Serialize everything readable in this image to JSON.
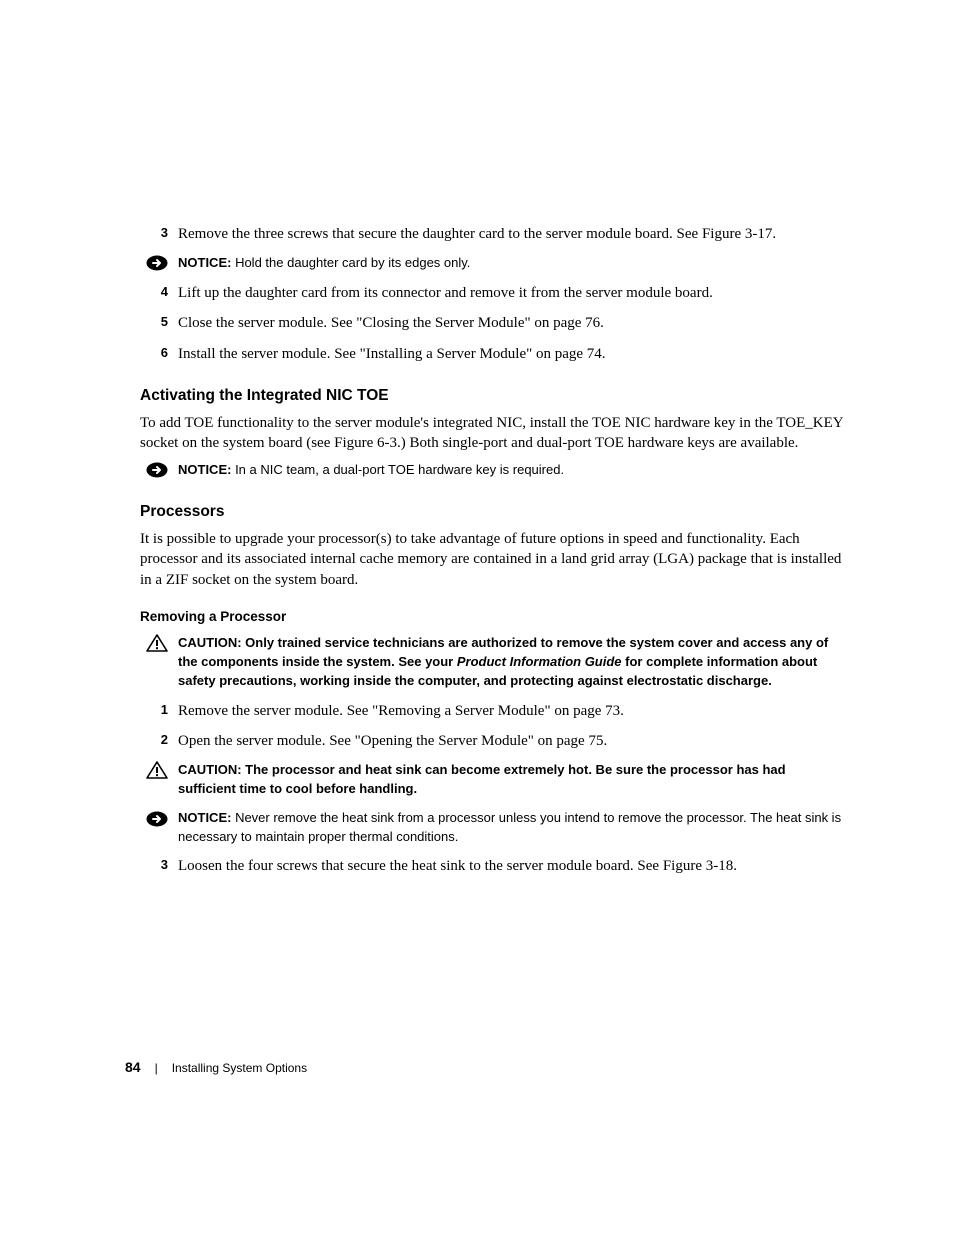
{
  "step3": {
    "num": "3",
    "text": "Remove the three screws that secure the daughter card to the server module board. See Figure 3-17."
  },
  "notice1": {
    "label": "NOTICE:",
    "text": " Hold the daughter card by its edges only."
  },
  "step4": {
    "num": "4",
    "text": "Lift up the daughter card from its connector and remove it from the server module board."
  },
  "step5": {
    "num": "5",
    "text": "Close the server module. See \"Closing the Server Module\" on page 76."
  },
  "step6": {
    "num": "6",
    "text": "Install the server module. See \"Installing a Server Module\" on page 74."
  },
  "sec1": {
    "title": "Activating the Integrated NIC TOE",
    "para": "To add TOE functionality to the server module's integrated NIC, install the TOE NIC hardware key in the TOE_KEY socket on the system board (see Figure 6-3.) Both single-port and dual-port TOE hardware keys are available."
  },
  "notice2": {
    "label": "NOTICE:",
    "text": " In a NIC team, a dual-port TOE hardware key is required."
  },
  "sec2": {
    "title": "Processors",
    "para": "It is possible to upgrade your processor(s) to take advantage of future options in speed and functionality. Each processor and its associated internal cache memory are contained in a land grid array (LGA) package that is installed in a ZIF socket on the system board."
  },
  "sub1": {
    "title": "Removing a Processor"
  },
  "caution1": {
    "label": "CAUTION:",
    "t1": " Only trained service technicians are authorized to remove the system cover and access any of the components inside the system. See your ",
    "italic": "Product Information Guide",
    "t2": " for complete information about safety precautions, working inside the computer, and protecting against electrostatic discharge."
  },
  "pstep1": {
    "num": "1",
    "text": "Remove the server module. See \"Removing a Server Module\" on page 73."
  },
  "pstep2": {
    "num": "2",
    "text": "Open the server module. See \"Opening the Server Module\" on page 75."
  },
  "caution2": {
    "label": "CAUTION:",
    "text": " The processor and heat sink can become extremely hot. Be sure the processor has had sufficient time to cool before handling."
  },
  "notice3": {
    "label": "NOTICE:",
    "text": " Never remove the heat sink from a processor unless you intend to remove the processor. The heat sink is necessary to maintain proper thermal conditions."
  },
  "pstep3": {
    "num": "3",
    "text": "Loosen the four screws that secure the heat sink to the server module board. See Figure 3-18."
  },
  "footer": {
    "page": "84",
    "section": "Installing System Options"
  }
}
